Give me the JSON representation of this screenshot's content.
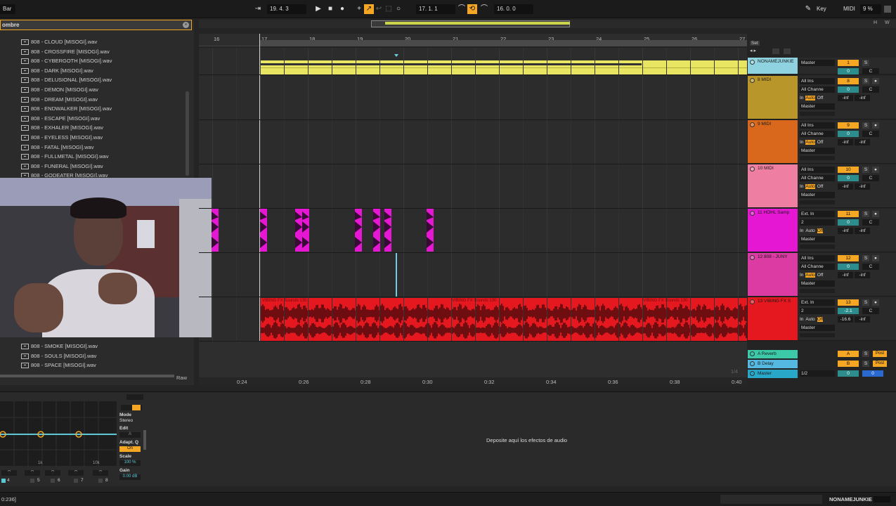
{
  "topbar": {
    "bar_label": "Bar",
    "position": "19.  4.  3",
    "loop_start": "17.  1.  1",
    "loop_length": "16.  0.  0",
    "key_label": "Key",
    "midi_label": "MIDI",
    "cpu": "9 %"
  },
  "browser": {
    "header": "ombre",
    "raw_label": "Raw",
    "files": [
      "808 - CLOUD [MISOGI].wav",
      "808 - CROSSFIRE [MISOGI].wav",
      "808 - CYBERGOTH [MISOGI].wav",
      "808 - DARK [MISOGI].wav",
      "808 - DELUSIONAL [MISOGI].wav",
      "808 - DEMON [MISOGI].wav",
      "808 - DREAM [MISOGI].wav",
      "808 - ENDWALKER [MISOGI].wav",
      "808 - ESCAPE [MISOGI].wav",
      "808 - EXHALER [MISOGI].wav",
      "808 - EYELESS [MISOGI].wav",
      "808 - FATAL [MISOGI].wav",
      "808 - FULLMETAL [MISOGI].wav",
      "808 - FUNERAL [MISOGI].wav",
      "808 - GODEATER [MISOGI].wav"
    ],
    "files_bottom": [
      "808 - SMOKE [MISOGI].wav",
      "808 - SOULS [MISOGI].wav",
      "808 - SPACE [MISOGI].wav"
    ]
  },
  "ruler": {
    "bars": [
      "16",
      "17",
      "18",
      "19",
      "20",
      "21",
      "22",
      "23",
      "24",
      "25",
      "26",
      "27"
    ],
    "set_label": "Set"
  },
  "time_ruler": [
    "0:24",
    "0:26",
    "0:28",
    "0:30",
    "0:32",
    "0:34",
    "0:36",
    "0:38",
    "0:40"
  ],
  "tracks": [
    {
      "name": "NONAMEJUNKIE",
      "color": "#8fd3e0",
      "route1": "Master",
      "route2": "",
      "num": "1",
      "vol": "0",
      "pan": "C"
    },
    {
      "name": "8 MIDI",
      "color": "#b8962a",
      "route1": "All Ins",
      "route2": "All Channe",
      "route3": "Master",
      "num": "8",
      "vol": "0",
      "pan": "C",
      "send1": "-inf",
      "send2": "-inf"
    },
    {
      "name": "9 MIDI",
      "color": "#d9681c",
      "route1": "All Ins",
      "route2": "All Channe",
      "route3": "Master",
      "num": "9",
      "vol": "0",
      "pan": "C",
      "send1": "-inf",
      "send2": "-inf"
    },
    {
      "name": "10 MIDI",
      "color": "#ef7fa2",
      "route1": "All Ins",
      "route2": "All Channe",
      "route3": "Master",
      "num": "10",
      "vol": "0",
      "pan": "C",
      "send1": "-inf",
      "send2": "-inf"
    },
    {
      "name": "11 HOHL Samp",
      "color": "#e517d3",
      "route1": "Ext. In",
      "route2": "2",
      "route3": "Master",
      "num": "11",
      "vol": "0",
      "pan": "C",
      "send1": "-inf",
      "send2": "-inf"
    },
    {
      "name": "12 808 - JUNY",
      "color": "#dc3ba3",
      "route1": "All Ins",
      "route2": "All Channe",
      "route3": "Master",
      "num": "12",
      "vol": "0",
      "pan": "C",
      "send1": "-inf",
      "send2": "-inf"
    },
    {
      "name": "13 VIBING FX S",
      "color": "#e5171f",
      "route1": "Ext. In",
      "route2": "2",
      "route3": "Master",
      "num": "13",
      "vol": "-2.1",
      "pan": "C",
      "send1": "-16.6",
      "send2": "-inf"
    }
  ],
  "returns": [
    {
      "name": "A Reverb",
      "color": "#3bc9a8",
      "num": "A",
      "post": "Post"
    },
    {
      "name": "B Delay",
      "color": "#55b8e0",
      "num": "B",
      "post": "Post"
    },
    {
      "name": "Master",
      "color": "#29a7c9",
      "route": "1/2",
      "vol": "0",
      "pan": "0"
    }
  ],
  "io": {
    "in": "In",
    "auto": "Auto",
    "off": "Off"
  },
  "clip_label": "VIBING FX Sounds 130",
  "device": {
    "drop_text": "Deposite aquí los efectos de audio",
    "mode_label": "Mode",
    "mode_value": "Stereo",
    "edit_label": "Edit",
    "edit_value": "A",
    "adapt_label": "Adapt. Q",
    "adapt_value": "On",
    "scale_label": "Scale",
    "scale_value": "100 %",
    "gain_label": "Gain",
    "gain_value": "0.00 dB",
    "freq1": "1k",
    "freq2": "10k",
    "bands": [
      "4",
      "5",
      "6",
      "7",
      "8"
    ]
  },
  "status": {
    "left": "0:236]",
    "right": "NONAMEJUNKIE"
  },
  "overview_page": "1/4"
}
